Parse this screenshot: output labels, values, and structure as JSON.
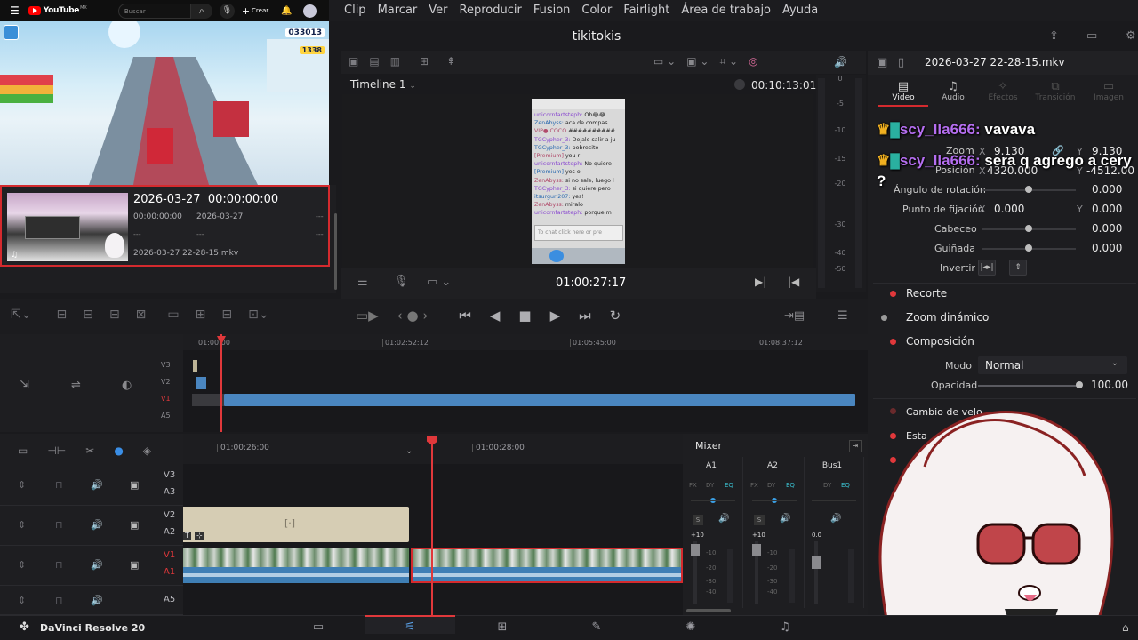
{
  "youtube": {
    "brand": "YouTube",
    "brand_suffix": "MX",
    "search_placeholder": "Buscar",
    "create_label": "Crear"
  },
  "menu": [
    "Clip",
    "Marcar",
    "Ver",
    "Reproducir",
    "Fusion",
    "Color",
    "Fairlight",
    "Área de trabajo",
    "Ayuda"
  ],
  "project_title": "tikitokis",
  "game": {
    "score": "033013",
    "coins": "1338"
  },
  "media_item": {
    "title": "2026-03-27  00:00:00:00",
    "tc": "00:00:00:00",
    "date": "2026-03-27",
    "dash1": "---",
    "dash2": "---",
    "dash3": "---",
    "dash4": "---",
    "file": "2026-03-27 22-28-15.mkv"
  },
  "viewer": {
    "timeline_name": "Timeline 1",
    "duration": "00:10:13:01",
    "timecode": "01:00:27:17",
    "meter_ticks": [
      "0",
      "-5",
      "-10",
      "-15",
      "-20",
      "-30",
      "-40",
      "-50"
    ]
  },
  "chat_preview": [
    {
      "user": "unicornfartsteph:",
      "msg": "Oh😂😂"
    },
    {
      "user": "ZenAbyss:",
      "msg": "aca de compas"
    },
    {
      "user": "VIP● COCO",
      "msg": "##########"
    },
    {
      "user": "TGCypher_3:",
      "msg": "Dejalo salir a ju"
    },
    {
      "user": "TGCypher_3:",
      "msg": "pobrecito"
    },
    {
      "user": "[Premium]",
      "msg": "you r"
    },
    {
      "user": "unicornfartsteph:",
      "msg": "No quiere"
    },
    {
      "user": "[Premium]",
      "msg": "yes o"
    },
    {
      "user": "ZenAbyss:",
      "msg": "si no sale, luego l"
    },
    {
      "user": "TGCypher_3:",
      "msg": "si quiere pero"
    },
    {
      "user": "itsurgurl207:",
      "msg": "yes!"
    },
    {
      "user": "ZenAbyss:",
      "msg": "miralo"
    },
    {
      "user": "unicornfartsteph:",
      "msg": "porque m"
    }
  ],
  "chat_input_placeholder": "To chat click here or pre",
  "inspector": {
    "filename": "2026-03-27 22-28-15.mkv",
    "tabs": [
      "Video",
      "Audio",
      "Efectos",
      "Transición",
      "Imagen"
    ],
    "zoom_label": "Zoom",
    "zoom_x": "9.130",
    "zoom_y": "9.130",
    "pos_label": "Posición",
    "pos_x": "4320.000",
    "pos_y": "-4512.00",
    "rot_label": "Ángulo de rotación",
    "rot_val": "0.000",
    "anchor_label": "Punto de fijación",
    "anchor_x": "0.000",
    "anchor_y": "0.000",
    "pitch_label": "Cabeceo",
    "pitch_val": "0.000",
    "yaw_label": "Guiñada",
    "yaw_val": "0.000",
    "flip_label": "Invertir",
    "sections": [
      "Recorte",
      "Zoom dinámico",
      "Composición"
    ],
    "mode_label": "Modo",
    "mode_val": "Normal",
    "opacity_label": "Opacidad",
    "opacity_val": "100.00",
    "speed_label": "Cambio de velo",
    "stab_label": "Esta",
    "x_label": "X",
    "y_label": "Y"
  },
  "overlay_chat": [
    {
      "user": "scy_lla666:",
      "msg": "vavava"
    },
    {
      "user": "scy_lla666:",
      "msg": "sera q agrego a cery ?"
    }
  ],
  "upper_timeline": {
    "ruler": [
      "01:00:00",
      "01:02:52:12",
      "01:05:45:00",
      "01:08:37:12"
    ],
    "tracks": [
      "V3",
      "V2",
      "V1",
      "A5"
    ]
  },
  "lower_timeline": {
    "ruler": [
      "01:00:26:00",
      "01:00:28:00"
    ],
    "tracks": [
      {
        "v": "V3",
        "a": "A3"
      },
      {
        "v": "V2",
        "a": "A2"
      },
      {
        "v": "V1",
        "a": "A1"
      },
      {
        "v": "",
        "a": "A5"
      }
    ]
  },
  "mixer": {
    "title": "Mixer",
    "channels": [
      "A1",
      "A2",
      "Bus1"
    ],
    "fx": "FX",
    "dy": "DY",
    "eq": "EQ",
    "s": "S",
    "levels": [
      "+10",
      "+10",
      "0.0"
    ],
    "scale": [
      "-10",
      "-20",
      "-30",
      "-40"
    ]
  },
  "app_name": "DaVinci Resolve 20",
  "colors": {
    "accent": "#e0383b",
    "clip_blue": "#3f7fb5",
    "clip_beige": "#d6cdb4"
  }
}
